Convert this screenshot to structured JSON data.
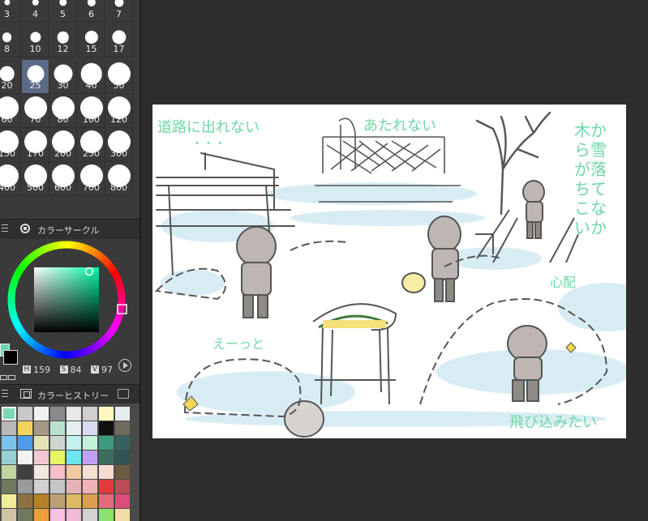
{
  "brush_size_panel": {
    "selected_size": "25",
    "rows": [
      [
        "3",
        "4",
        "5",
        "6",
        "7"
      ],
      [
        "8",
        "10",
        "12",
        "15",
        "17"
      ],
      [
        "20",
        "25",
        "30",
        "40",
        "50"
      ],
      [
        "60",
        "70",
        "80",
        "100",
        "120"
      ],
      [
        "150",
        "170",
        "200",
        "250",
        "300"
      ],
      [
        "400",
        "500",
        "600",
        "700",
        "800"
      ]
    ]
  },
  "color_circle_panel": {
    "title": "カラーサークル",
    "hsv": {
      "h_label": "H",
      "h": "159",
      "s_label": "S",
      "s": "84",
      "v_label": "V",
      "v": "97"
    },
    "foreground_color": "#6ad7b0",
    "background_color": "#000000"
  },
  "color_history_panel": {
    "title": "カラーヒストリー",
    "rows": [
      [
        "#7dd9b5",
        "#c9c9c9",
        "#f1f1f1",
        "#8a8a8a",
        "#e9e9e9",
        "#cfd0cf",
        "#fff7bf",
        "#e6ecee"
      ],
      [
        "#b8b8b8",
        "#f3d35a",
        "#a79985",
        "#b7e2cf",
        "#e5efef",
        "#d9d9ef",
        "#0f0f0f",
        "#6e6a5c"
      ],
      [
        "#7cc3ec",
        "#4d9cec",
        "#e8e3b6",
        "#cbd7d0",
        "#c4f0ef",
        "#c3f1d9",
        "#3d9a7e",
        "#35625f"
      ],
      [
        "#96d0d4",
        "#f3f3f3",
        "#f4c8d0",
        "#e7f564",
        "#6ee5ef",
        "#c0a0f2",
        "#3a6d5b",
        "#2f5554"
      ],
      [
        "#c1d69f",
        "#3f3f3f",
        "#f1eadc",
        "#f6bfc8",
        "#f3caa2",
        "#f4dfd3",
        "#f5ddd2",
        "#6d5a42"
      ],
      [
        "#6d7a5e",
        "#9a9a9a",
        "#cfd0cf",
        "#c6c6c6",
        "#e6b4b8",
        "#efb1b8",
        "#e13a3a",
        "#bd4d54"
      ],
      [
        "#f0ec9a",
        "#8e7041",
        "#b77f27",
        "#bba073",
        "#dcbc63",
        "#dd9f4f",
        "#e26a79",
        "#dd4d7a"
      ],
      [
        "#d0c4a2",
        "#6e7a5d",
        "#ed9d3e",
        "#f6c1de",
        "#f1bad9",
        "#d2d2d2",
        "#8be36a",
        "#f3dca9"
      ]
    ]
  },
  "canvas": {
    "annotation_road": "道路に出れない",
    "annotation_dots": "・・・",
    "annotation_warm": "あたれない",
    "annotation_tree": "木から雪が落ちてこないか",
    "annotation_worry": "心配",
    "annotation_whoosh": "えーっと",
    "annotation_jump": "飛び込みたい"
  }
}
